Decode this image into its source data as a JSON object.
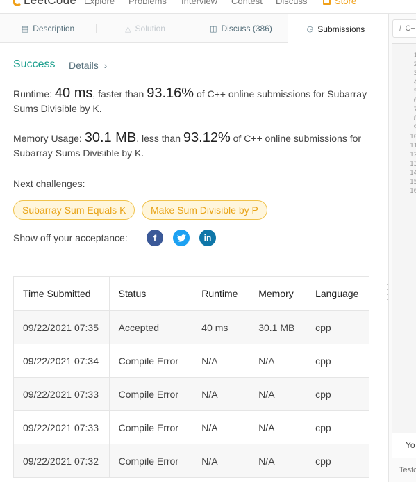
{
  "topnav": {
    "logo_text": "LeetCode",
    "items": [
      "Explore",
      "Problems",
      "Interview",
      "Contest",
      "Discuss",
      "Store"
    ]
  },
  "tabs": [
    {
      "label": "Description",
      "icon": "document-icon"
    },
    {
      "label": "Solution",
      "icon": "flask-icon"
    },
    {
      "label": "Discuss (386)",
      "icon": "comment-icon"
    },
    {
      "label": "Submissions",
      "icon": "clock-icon"
    }
  ],
  "result": {
    "status": "Success",
    "details_label": "Details",
    "runtime_label": "Runtime:",
    "runtime_value": "40 ms",
    "runtime_mid": ", faster than",
    "runtime_pct": "93.16%",
    "runtime_tail": "of C++ online submissions for Subarray Sums Divisible by K.",
    "memory_label": "Memory Usage:",
    "memory_value": "30.1 MB",
    "memory_mid": ", less than",
    "memory_pct": "93.12%",
    "memory_tail": "of C++ online submissions for Subarray Sums Divisible by K."
  },
  "challenges": {
    "label": "Next challenges:",
    "items": [
      "Subarray Sum Equals K",
      "Make Sum Divisible by P"
    ]
  },
  "share": {
    "label": "Show off your acceptance:",
    "icons": [
      "facebook-icon",
      "twitter-icon",
      "linkedin-icon"
    ],
    "colors": {
      "facebook": "#3b5998",
      "twitter": "#1da1f2",
      "linkedin": "#0e76a8"
    }
  },
  "table": {
    "headers": [
      "Time Submitted",
      "Status",
      "Runtime",
      "Memory",
      "Language"
    ],
    "rows": [
      {
        "time": "09/22/2021 07:35",
        "status": "Accepted",
        "runtime": "40 ms",
        "memory": "30.1 MB",
        "language": "cpp"
      },
      {
        "time": "09/22/2021 07:34",
        "status": "Compile Error",
        "runtime": "N/A",
        "memory": "N/A",
        "language": "cpp"
      },
      {
        "time": "09/22/2021 07:33",
        "status": "Compile Error",
        "runtime": "N/A",
        "memory": "N/A",
        "language": "cpp"
      },
      {
        "time": "09/22/2021 07:33",
        "status": "Compile Error",
        "runtime": "N/A",
        "memory": "N/A",
        "language": "cpp"
      },
      {
        "time": "09/22/2021 07:32",
        "status": "Compile Error",
        "runtime": "N/A",
        "memory": "N/A",
        "language": "cpp"
      }
    ]
  },
  "editor": {
    "lang_label": "C+",
    "line_numbers": [
      "1",
      "2",
      "3",
      "4",
      "5",
      "6",
      "7",
      "8",
      "9",
      "10",
      "11",
      "12",
      "13",
      "14",
      "15",
      "16"
    ],
    "bottom_label": "Yo",
    "testcase_label": "Testc"
  },
  "colors": {
    "accent_green": "#1a9e8c",
    "error_red": "#c6162f",
    "chip_orange": "#e8a317"
  }
}
